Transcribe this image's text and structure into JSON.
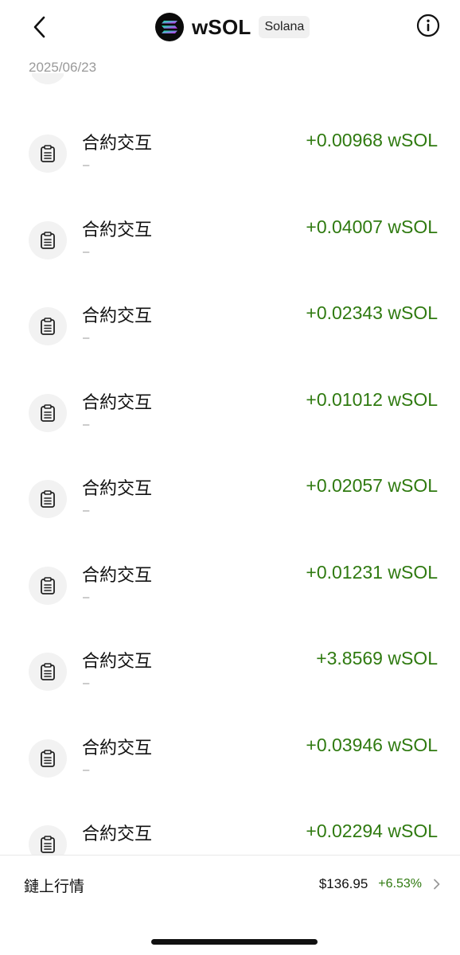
{
  "header": {
    "token_symbol": "wSOL",
    "chain": "Solana",
    "back_icon": "chevron-left-icon",
    "info_icon": "info-circle-icon",
    "logo_icon": "solana-logo-icon"
  },
  "date_group": {
    "date": "2025/06/23"
  },
  "transactions": [
    {
      "title": "合約交互",
      "subtitle": "–",
      "amount": "+0.00968 wSOL"
    },
    {
      "title": "合約交互",
      "subtitle": "–",
      "amount": "+0.04007 wSOL"
    },
    {
      "title": "合約交互",
      "subtitle": "–",
      "amount": "+0.02343 wSOL"
    },
    {
      "title": "合約交互",
      "subtitle": "–",
      "amount": "+0.01012 wSOL"
    },
    {
      "title": "合約交互",
      "subtitle": "–",
      "amount": "+0.02057 wSOL"
    },
    {
      "title": "合約交互",
      "subtitle": "–",
      "amount": "+0.01231 wSOL"
    },
    {
      "title": "合約交互",
      "subtitle": "–",
      "amount": "+3.8569 wSOL"
    },
    {
      "title": "合約交互",
      "subtitle": "–",
      "amount": "+0.03946 wSOL"
    },
    {
      "title": "合約交互",
      "subtitle": "–",
      "amount": "+0.02294 wSOL"
    }
  ],
  "market": {
    "label": "鏈上行情",
    "price": "$136.95",
    "change": "+6.53%"
  },
  "colors": {
    "positive": "#2f7a10",
    "muted": "#9a9a9a"
  }
}
